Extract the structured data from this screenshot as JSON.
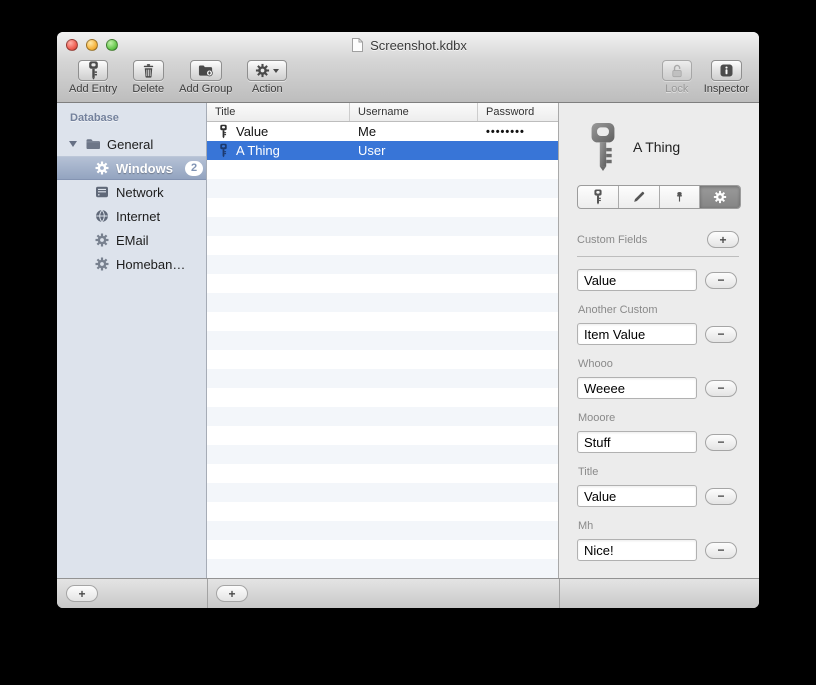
{
  "window": {
    "title": "Screenshot.kdbx"
  },
  "toolbar": {
    "add_entry": "Add Entry",
    "delete": "Delete",
    "add_group": "Add Group",
    "action": "Action",
    "lock": "Lock",
    "inspector": "Inspector"
  },
  "sidebar": {
    "header": "Database",
    "items": [
      {
        "label": "General",
        "icon": "folder",
        "expanded": true
      },
      {
        "label": "Windows",
        "icon": "gear",
        "badge": "2",
        "selected": true
      },
      {
        "label": "Network",
        "icon": "server"
      },
      {
        "label": "Internet",
        "icon": "globe"
      },
      {
        "label": "EMail",
        "icon": "gear"
      },
      {
        "label": "Homeban…",
        "icon": "gear"
      }
    ]
  },
  "table": {
    "columns": [
      "Title",
      "Username",
      "Password"
    ],
    "rows": [
      {
        "title": "Value",
        "username": "Me",
        "password": "••••••••",
        "selected": false
      },
      {
        "title": "A Thing",
        "username": "User",
        "password": "",
        "selected": true
      }
    ]
  },
  "inspector": {
    "entry_title": "A Thing",
    "tabs": [
      "key-tab",
      "pencil-tab",
      "pushpin-tab",
      "gear-tab"
    ],
    "selected_tab": "gear-tab",
    "section_label": "Custom Fields",
    "fields": [
      {
        "label": "",
        "value": "Value"
      },
      {
        "label": "Another Custom",
        "value": "Item Value"
      },
      {
        "label": "Whooo",
        "value": "Weeee"
      },
      {
        "label": "Mooore",
        "value": "Stuff"
      },
      {
        "label": "Title",
        "value": "Value"
      },
      {
        "label": "Mh",
        "value": "Nice!"
      }
    ]
  },
  "controls": {
    "add_glyph": "+",
    "remove_glyph": "−"
  },
  "colors": {
    "selection_blue": "#3875d7",
    "sidebar_selection": "#9aa9c4",
    "sidebar_bg": "#dde3ec",
    "stripe_blue": "#f3f6fa"
  }
}
